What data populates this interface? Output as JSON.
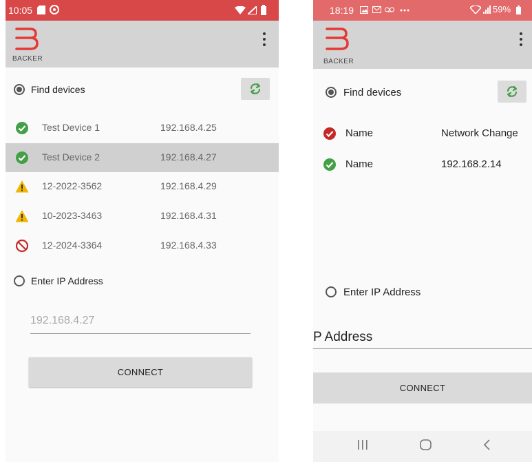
{
  "left": {
    "status_time": "10:05",
    "logo_text": "BACKER",
    "find_devices_label": "Find devices",
    "devices": [
      {
        "name": "Test Device 1",
        "ip": "192.168.4.25",
        "status": "ok",
        "icon": "check-circle-icon",
        "color": "#43a047"
      },
      {
        "name": "Test Device 2",
        "ip": "192.168.4.27",
        "status": "ok",
        "icon": "check-circle-icon",
        "color": "#43a047",
        "selected": true
      },
      {
        "name": "12-2022-3562",
        "ip": "192.168.4.29",
        "status": "warning",
        "icon": "warning-triangle-icon",
        "color": "#f2b600"
      },
      {
        "name": "10-2023-3463",
        "ip": "192.168.4.31",
        "status": "warning",
        "icon": "warning-triangle-icon",
        "color": "#f2b600"
      },
      {
        "name": "12-2024-3364",
        "ip": "192.168.4.33",
        "status": "blocked",
        "icon": "prohibited-icon",
        "color": "#c62828"
      }
    ],
    "enter_ip_label": "Enter IP Address",
    "ip_value": "192.168.4.27",
    "connect_label": "CONNECT"
  },
  "right": {
    "status_time": "18:19",
    "status_battery": "59%",
    "logo_text": "BACKER",
    "find_devices_label": "Find devices",
    "devices": [
      {
        "name": "Name",
        "ip": "Network Change",
        "status": "error",
        "icon": "error-check-icon",
        "color": "#c62828"
      },
      {
        "name": "Name",
        "ip": "192.168.2.14",
        "status": "ok",
        "icon": "check-circle-icon",
        "color": "#43a047"
      }
    ],
    "enter_ip_label": "Enter IP Address",
    "ip_placeholder": "P Address",
    "connect_label": "CONNECT"
  },
  "colors": {
    "accent_green": "#43a047",
    "status_bar_left": "#d84848",
    "status_bar_right": "#e36a6a",
    "logo_red": "#e53935"
  }
}
